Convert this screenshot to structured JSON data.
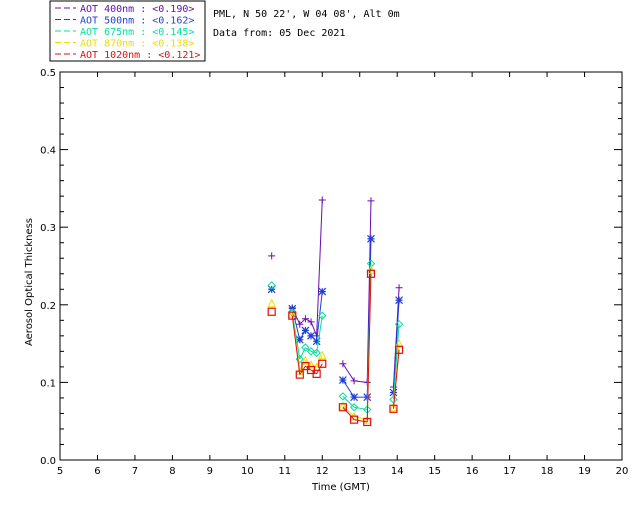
{
  "header": {
    "site_line": "PML, N 50 22', W 04 08', Alt 0m",
    "date_line": "Data from: 05 Dec 2021"
  },
  "chart_data": {
    "type": "line",
    "xlabel": "Time (GMT)",
    "ylabel": "Aerosol Optical Thickness",
    "xlim": [
      5,
      20
    ],
    "ylim": [
      0,
      0.5
    ],
    "xticks": [
      5,
      6,
      7,
      8,
      9,
      10,
      11,
      12,
      13,
      14,
      15,
      16,
      17,
      18,
      19,
      20
    ],
    "yticks": [
      0.0,
      0.1,
      0.2,
      0.3,
      0.4,
      0.5
    ],
    "ytick_labels": [
      "0.0",
      "0.1",
      "0.2",
      "0.3",
      "0.4",
      "0.5"
    ],
    "grid": false,
    "legend_position": "top-left",
    "series": [
      {
        "name": "AOT  400nm : <0.190>",
        "color": "#6a0dad",
        "marker": "plus",
        "points": [
          [
            10.65,
            0.263
          ],
          [
            11.2,
            0.196
          ],
          [
            11.4,
            0.175
          ],
          [
            11.55,
            0.182
          ],
          [
            11.7,
            0.178
          ],
          [
            11.85,
            0.16
          ],
          [
            12.0,
            0.335
          ],
          [
            12.55,
            0.124
          ],
          [
            12.85,
            0.102
          ],
          [
            13.2,
            0.1
          ],
          [
            13.3,
            0.334
          ],
          [
            13.9,
            0.094
          ],
          [
            14.05,
            0.222
          ]
        ]
      },
      {
        "name": "AOT  500nm : <0.162>",
        "color": "#1f3fd8",
        "marker": "star",
        "points": [
          [
            10.65,
            0.22
          ],
          [
            11.2,
            0.195
          ],
          [
            11.4,
            0.155
          ],
          [
            11.55,
            0.167
          ],
          [
            11.7,
            0.16
          ],
          [
            11.85,
            0.153
          ],
          [
            12.0,
            0.217
          ],
          [
            12.55,
            0.103
          ],
          [
            12.85,
            0.081
          ],
          [
            13.2,
            0.081
          ],
          [
            13.3,
            0.285
          ],
          [
            13.9,
            0.087
          ],
          [
            14.05,
            0.206
          ]
        ]
      },
      {
        "name": "AOT  675nm : <0.145>",
        "color": "#00e0a0",
        "marker": "diamond",
        "points": [
          [
            10.65,
            0.225
          ],
          [
            11.2,
            0.19
          ],
          [
            11.4,
            0.13
          ],
          [
            11.55,
            0.145
          ],
          [
            11.7,
            0.14
          ],
          [
            11.85,
            0.138
          ],
          [
            12.0,
            0.186
          ],
          [
            12.55,
            0.082
          ],
          [
            12.85,
            0.068
          ],
          [
            13.2,
            0.065
          ],
          [
            13.3,
            0.253
          ],
          [
            13.9,
            0.078
          ],
          [
            14.05,
            0.175
          ]
        ]
      },
      {
        "name": "AOT  870nm : <0.138>",
        "color": "#e8e000",
        "marker": "triangle",
        "points": [
          [
            10.65,
            0.202
          ],
          [
            11.2,
            0.188
          ],
          [
            11.4,
            0.115
          ],
          [
            11.55,
            0.128
          ],
          [
            11.7,
            0.123
          ],
          [
            11.85,
            0.12
          ],
          [
            12.0,
            0.135
          ],
          [
            12.55,
            0.07
          ],
          [
            12.85,
            0.056
          ],
          [
            13.2,
            0.052
          ],
          [
            13.3,
            0.245
          ],
          [
            13.9,
            0.068
          ],
          [
            14.05,
            0.15
          ]
        ]
      },
      {
        "name": "AOT 1020nm : <0.121>",
        "color": "#dd1111",
        "marker": "square",
        "points": [
          [
            10.65,
            0.191
          ],
          [
            11.2,
            0.186
          ],
          [
            11.4,
            0.11
          ],
          [
            11.55,
            0.121
          ],
          [
            11.7,
            0.116
          ],
          [
            11.85,
            0.111
          ],
          [
            12.0,
            0.124
          ],
          [
            12.55,
            0.068
          ],
          [
            12.85,
            0.052
          ],
          [
            13.2,
            0.049
          ],
          [
            13.3,
            0.24
          ],
          [
            13.9,
            0.066
          ],
          [
            14.05,
            0.142
          ]
        ]
      }
    ]
  }
}
